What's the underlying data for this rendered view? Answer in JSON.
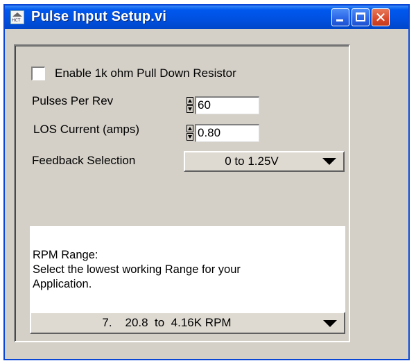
{
  "window": {
    "title": "Pulse Input Setup.vi",
    "icon_label": "HCT"
  },
  "controls": {
    "pulldown_label": "Enable 1k ohm Pull Down Resistor",
    "pulses_label": "Pulses Per Rev",
    "pulses_value": "60",
    "los_label": "LOS Current (amps)",
    "los_value": "0.80",
    "feedback_label": "Feedback  Selection",
    "feedback_value": "0 to 1.25V"
  },
  "rpm": {
    "title": "RPM Range:",
    "line1": "Select the lowest working Range for your",
    "line2": "Application.",
    "value": "7.    20.8  to  4.16K RPM"
  },
  "colors": {
    "titlebar": "#0050e0",
    "panel": "#d4d0c8",
    "close": "#d9492a"
  }
}
